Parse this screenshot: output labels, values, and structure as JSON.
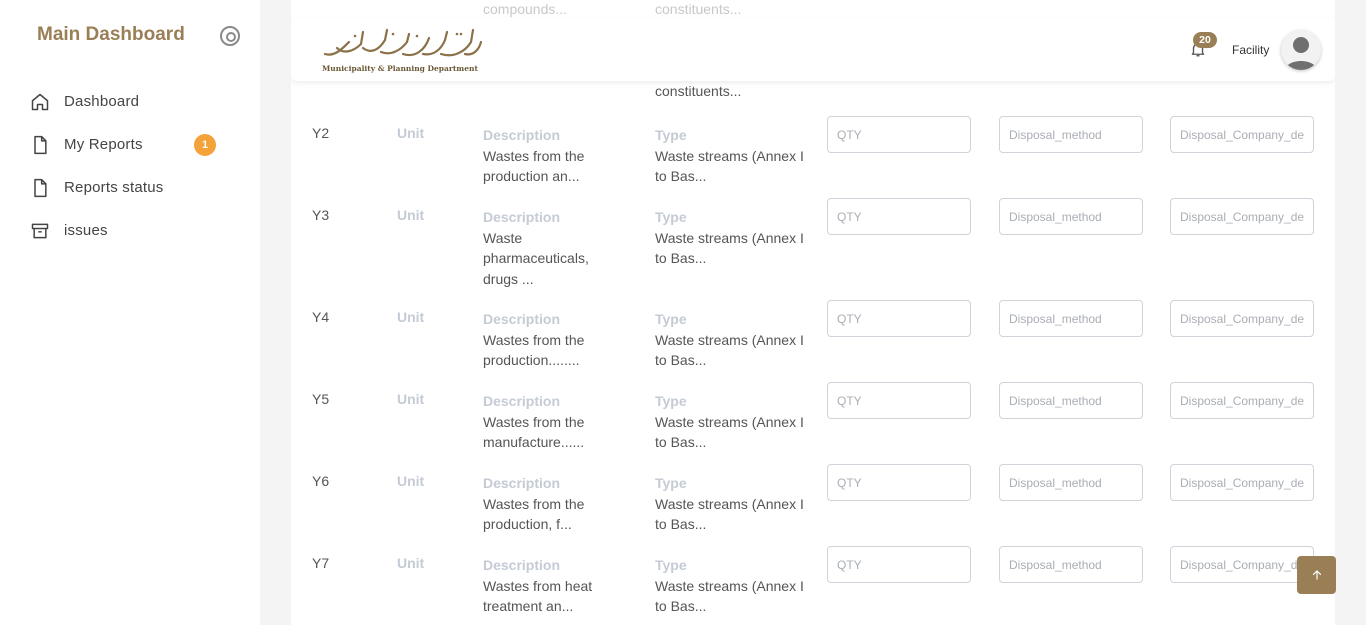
{
  "sidebar": {
    "title": "Main Dashboard",
    "items": [
      {
        "label": "Dashboard",
        "icon": "home-icon"
      },
      {
        "label": "My Reports",
        "icon": "document-icon",
        "badge": "1"
      },
      {
        "label": "Reports status",
        "icon": "document-icon"
      },
      {
        "label": "issues",
        "icon": "archive-icon"
      }
    ]
  },
  "header": {
    "logo_arabic": "دائرة البلدية والتخطيط",
    "logo_english": "Municipality & Planning Department",
    "notification_count": "20",
    "user_name": "Facility"
  },
  "ghost_text": {
    "desc": "compounds...",
    "type": "constituents..."
  },
  "above_row": {
    "type_text": "constituents..."
  },
  "labels": {
    "unit": "Unit",
    "description": "Description",
    "type": "Type"
  },
  "placeholders": {
    "qty": "QTY",
    "method": "Disposal_method",
    "company": "Disposal_Company_details"
  },
  "rows": [
    {
      "code": "Y2",
      "description": "Wastes from the production an...",
      "type": "Waste streams (Annex I to Bas..."
    },
    {
      "code": "Y3",
      "description": "Waste pharmaceuticals, drugs ...",
      "type": "Waste streams (Annex I to Bas..."
    },
    {
      "code": "Y4",
      "description": "Wastes from the production........",
      "type": "Waste streams (Annex I to Bas..."
    },
    {
      "code": "Y5",
      "description": "Wastes from the manufacture......",
      "type": "Waste streams (Annex I to Bas..."
    },
    {
      "code": "Y6",
      "description": "Wastes from the production, f...",
      "type": "Waste streams (Annex I to Bas..."
    },
    {
      "code": "Y7",
      "description": "Wastes from heat treatment an...",
      "type": "Waste streams (Annex I to Bas..."
    }
  ],
  "colors": {
    "brand": "#9a7f56",
    "badge_orange": "#f4a23a",
    "label_gray": "#c5cbd5"
  }
}
